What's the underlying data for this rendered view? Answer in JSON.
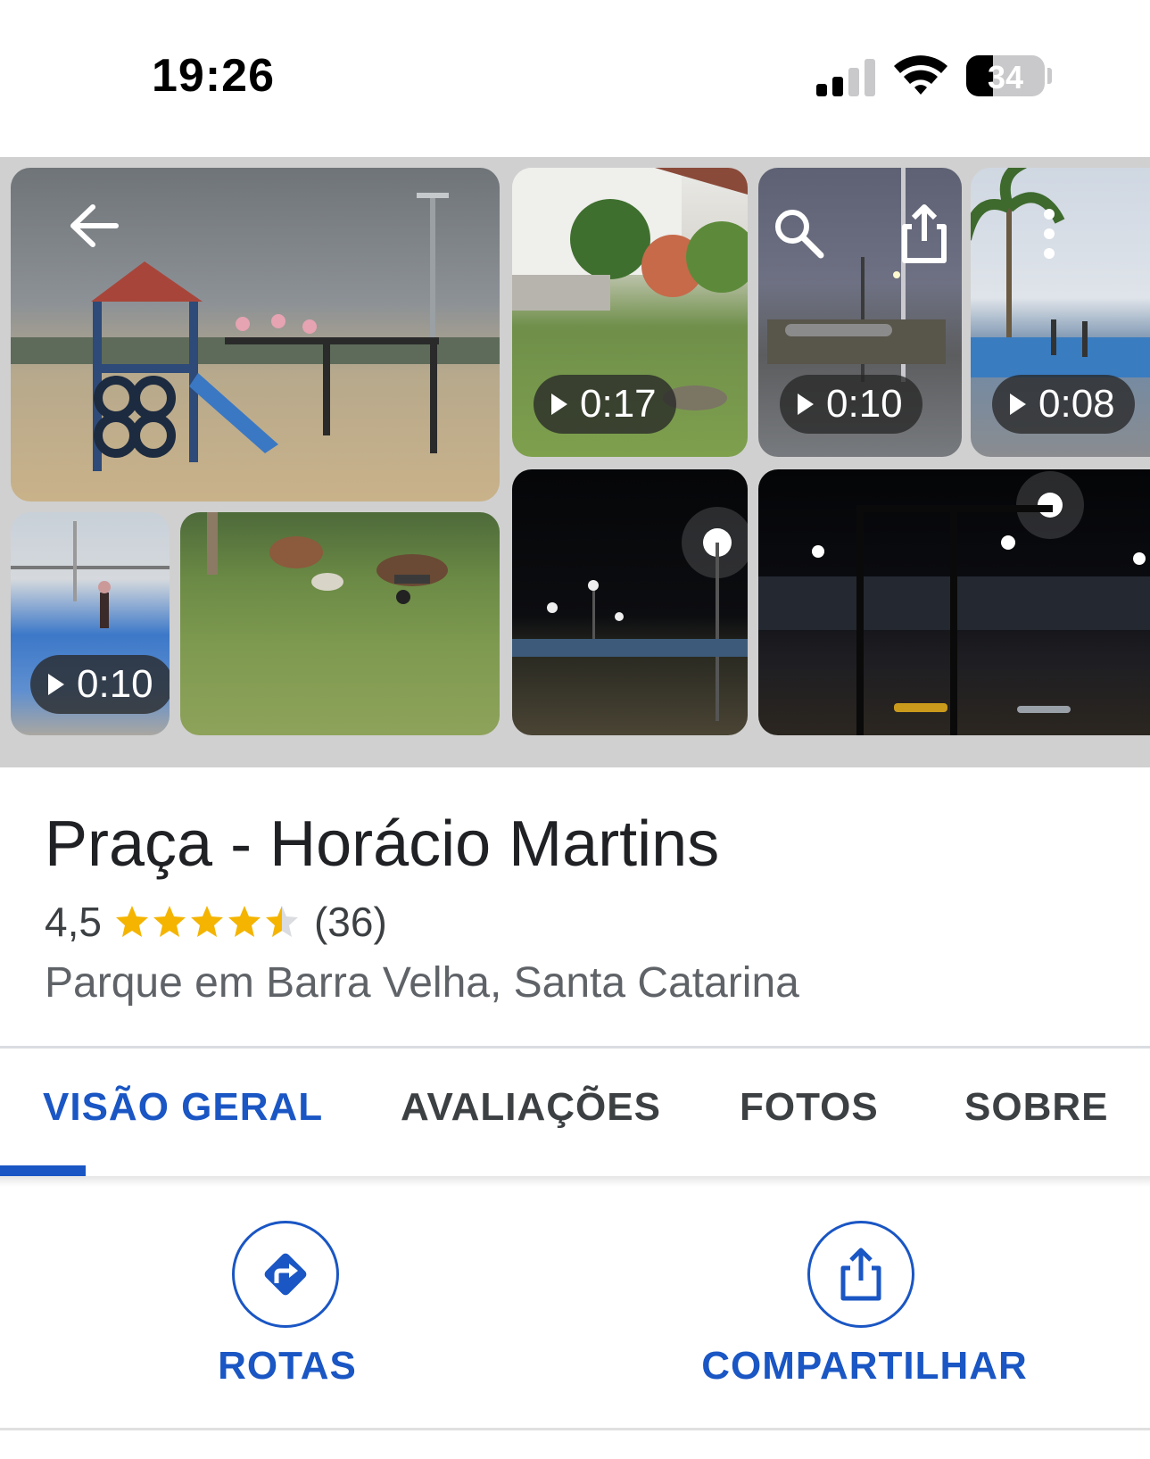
{
  "status_bar": {
    "time": "19:26",
    "battery": "34",
    "battery_level": 0.34
  },
  "gallery": {
    "videos": [
      {
        "duration": "0:17"
      },
      {
        "duration": "0:10"
      },
      {
        "duration": "0:08"
      },
      {
        "duration": "0:10"
      }
    ],
    "icons": [
      "back-arrow-icon",
      "search-icon",
      "share-icon",
      "more-vert-icon",
      "play-icon"
    ]
  },
  "place": {
    "name": "Praça - Horácio Martins",
    "rating": "4,5",
    "rating_value": 4.5,
    "review_count": "(36)",
    "category_location": "Parque em Barra Velha, Santa Catarina"
  },
  "tabs": [
    {
      "label": "VISÃO GERAL",
      "active": true
    },
    {
      "label": "AVALIAÇÕES",
      "active": false
    },
    {
      "label": "FOTOS",
      "active": false
    },
    {
      "label": "SOBRE",
      "active": false
    }
  ],
  "actions": [
    {
      "label": "ROTAS",
      "icon": "directions-icon"
    },
    {
      "label": "COMPARTILHAR",
      "icon": "share-icon"
    }
  ],
  "colors": {
    "accent": "#1a56c4",
    "star": "#f4b400",
    "star_empty": "#dadce0"
  }
}
